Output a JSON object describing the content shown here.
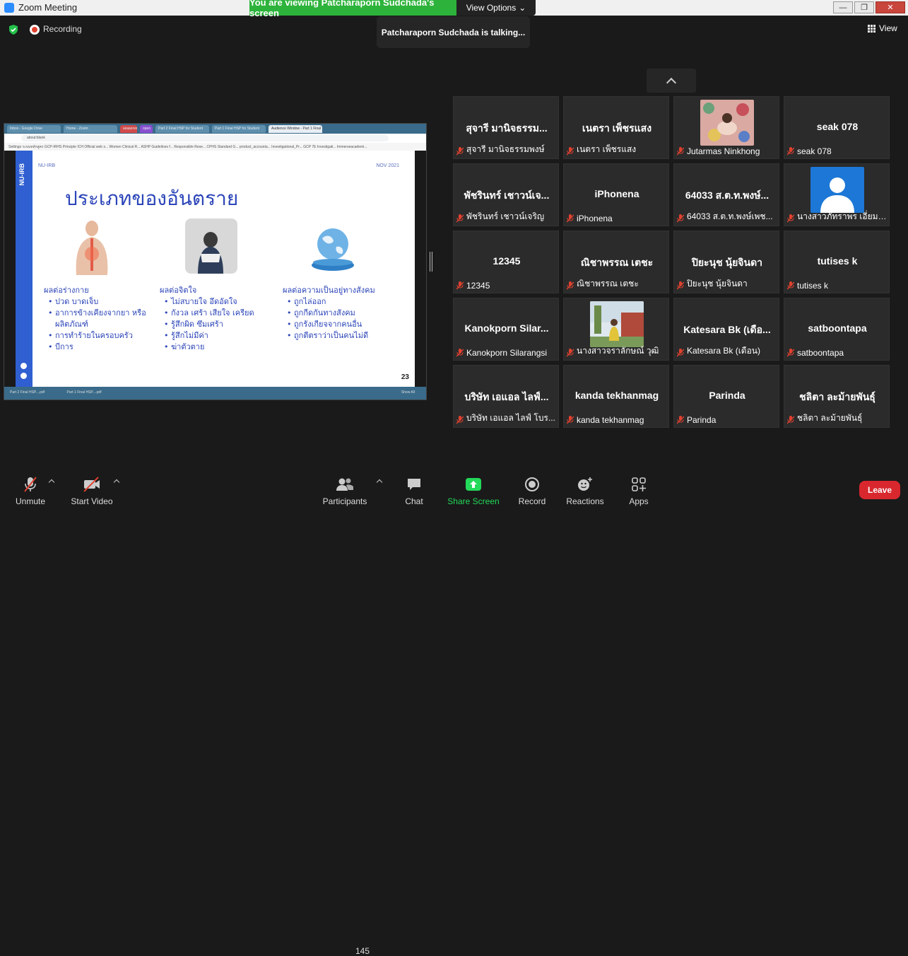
{
  "window": {
    "title": "Zoom Meeting",
    "minimize": "—",
    "maximize": "❐",
    "close": "✕"
  },
  "banner": {
    "text": "You are viewing Patcharaporn Sudchada's screen",
    "view_options": "View Options"
  },
  "status": {
    "recording": "Recording",
    "talking": "Patcharaporn Sudchada is talking...",
    "view": "View"
  },
  "browser": {
    "tabs": [
      "Inbox - Google Drive",
      "Home - Zoom",
      "",
      "",
      "Part 2 Final HSP for Student",
      "Part 1 Final HSP for Student",
      "Audience Window - Part 1 Final"
    ],
    "tab_badge_red": "seaserved",
    "tab_badge_purple": "open",
    "address": "about:blank",
    "bookmarks": "Settings   ระบบหลักสูตร   GCP-IRHS Principle   ICH Official web s...   Women Clinical R...   ASHP Guidelines f...   Responsible Rese...   CPHS Standard G...   product_accounta...   Investigational_Pr...   GCP 7E Investigati...   Immerseacademi...",
    "downloads": [
      "Part 2 Final HSP....pdf",
      "Part 1 Final HSP....pdf"
    ],
    "show_all": "Show All"
  },
  "slide": {
    "org": "NU-IRB",
    "org_side": "NU-IRB",
    "date": "NOV 2021",
    "title": "ประเภทของอันตราย",
    "page": "23",
    "columns": [
      {
        "heading": "ผลต่อร่างกาย",
        "items": [
          "ปวด บาดเจ็บ",
          "อาการข้างเคียงจากยา หรือ ผลิตภัณฑ์",
          "การทำร้ายในครอบครัว",
          "บีการ"
        ]
      },
      {
        "heading": "ผลต่อจิตใจ",
        "items": [
          "ไม่สบายใจ อึดอัดใจ",
          "กังวล เศร้า เสียใจ เครียด",
          "รู้สึกผิด ซึมเศร้า",
          "รู้สึกไม่มีค่า",
          "ฆ่าตัวตาย"
        ]
      },
      {
        "heading": "ผลต่อความเป็นอยู่ทางสังคม",
        "items": [
          "ถูกไล่ออก",
          "ถูกกีดกันทางสังคม",
          "ถูกรังเกียจจากคนอื่น",
          "ถูกตีตราว่าเป็นคนไม่ดี"
        ]
      }
    ]
  },
  "participants": [
    {
      "big": "สุจารี มานิจธรรม...",
      "name": "สุจารี มานิจธรรมพงษ์"
    },
    {
      "big": "เนตรา เพ็ชรแสง",
      "name": "เนตรา เพ็ชรแสง"
    },
    {
      "big": "",
      "name": "Jutarmas Ninkhong",
      "photo": "pattern"
    },
    {
      "big": "seak 078",
      "name": "seak 078"
    },
    {
      "big": "พัชรินทร์ เชาวน์เจ...",
      "name": "พัชรินทร์ เชาวน์เจริญ"
    },
    {
      "big": "iPhonena",
      "name": "iPhonena"
    },
    {
      "big": "64033 ส.ต.ท.พงษ์...",
      "name": "64033 ส.ต.ท.พงษ์เพช..."
    },
    {
      "big": "",
      "name": "นางสาวภัทราพร เอี่ยมเ...",
      "photo": "avatar"
    },
    {
      "big": "12345",
      "name": "12345"
    },
    {
      "big": "ณิชาพรรณ เตชะ",
      "name": "ณิชาพรรณ เตชะ"
    },
    {
      "big": "ปิยะนุช นุ้ยจินดา",
      "name": "ปิยะนุช นุ้ยจินดา"
    },
    {
      "big": "tutises k",
      "name": "tutises k"
    },
    {
      "big": "Kanokporn  Silar...",
      "name": "Kanokporn Silarangsi"
    },
    {
      "big": "",
      "name": "นางสาวจราลักษณ์ วุฒิ",
      "photo": "outdoor"
    },
    {
      "big": "Katesara Bk (เดือ...",
      "name": "Katesara Bk (เดือน)"
    },
    {
      "big": "satboontapa",
      "name": "satboontapa"
    },
    {
      "big": "บริษัท เอแอล ไลฟ์...",
      "name": "บริษัท เอแอล ไลฟ์ โบร..."
    },
    {
      "big": "kanda tekhanmag",
      "name": "kanda tekhanmag"
    },
    {
      "big": "Parinda",
      "name": "Parinda"
    },
    {
      "big": "ชลิตา ละม้ายพันธุ์",
      "name": "ชลิตา ละม้ายพันธุ์"
    }
  ],
  "toolbar": {
    "unmute": "Unmute",
    "start_video": "Start Video",
    "participants": "Participants",
    "participant_count": "145",
    "chat": "Chat",
    "share_screen": "Share Screen",
    "record": "Record",
    "reactions": "Reactions",
    "apps": "Apps",
    "leave": "Leave"
  },
  "colors": {
    "banner_green": "#2db33b",
    "leave_red": "#d9272e",
    "share_green": "#23d959",
    "slide_blue": "#2b44b8"
  }
}
